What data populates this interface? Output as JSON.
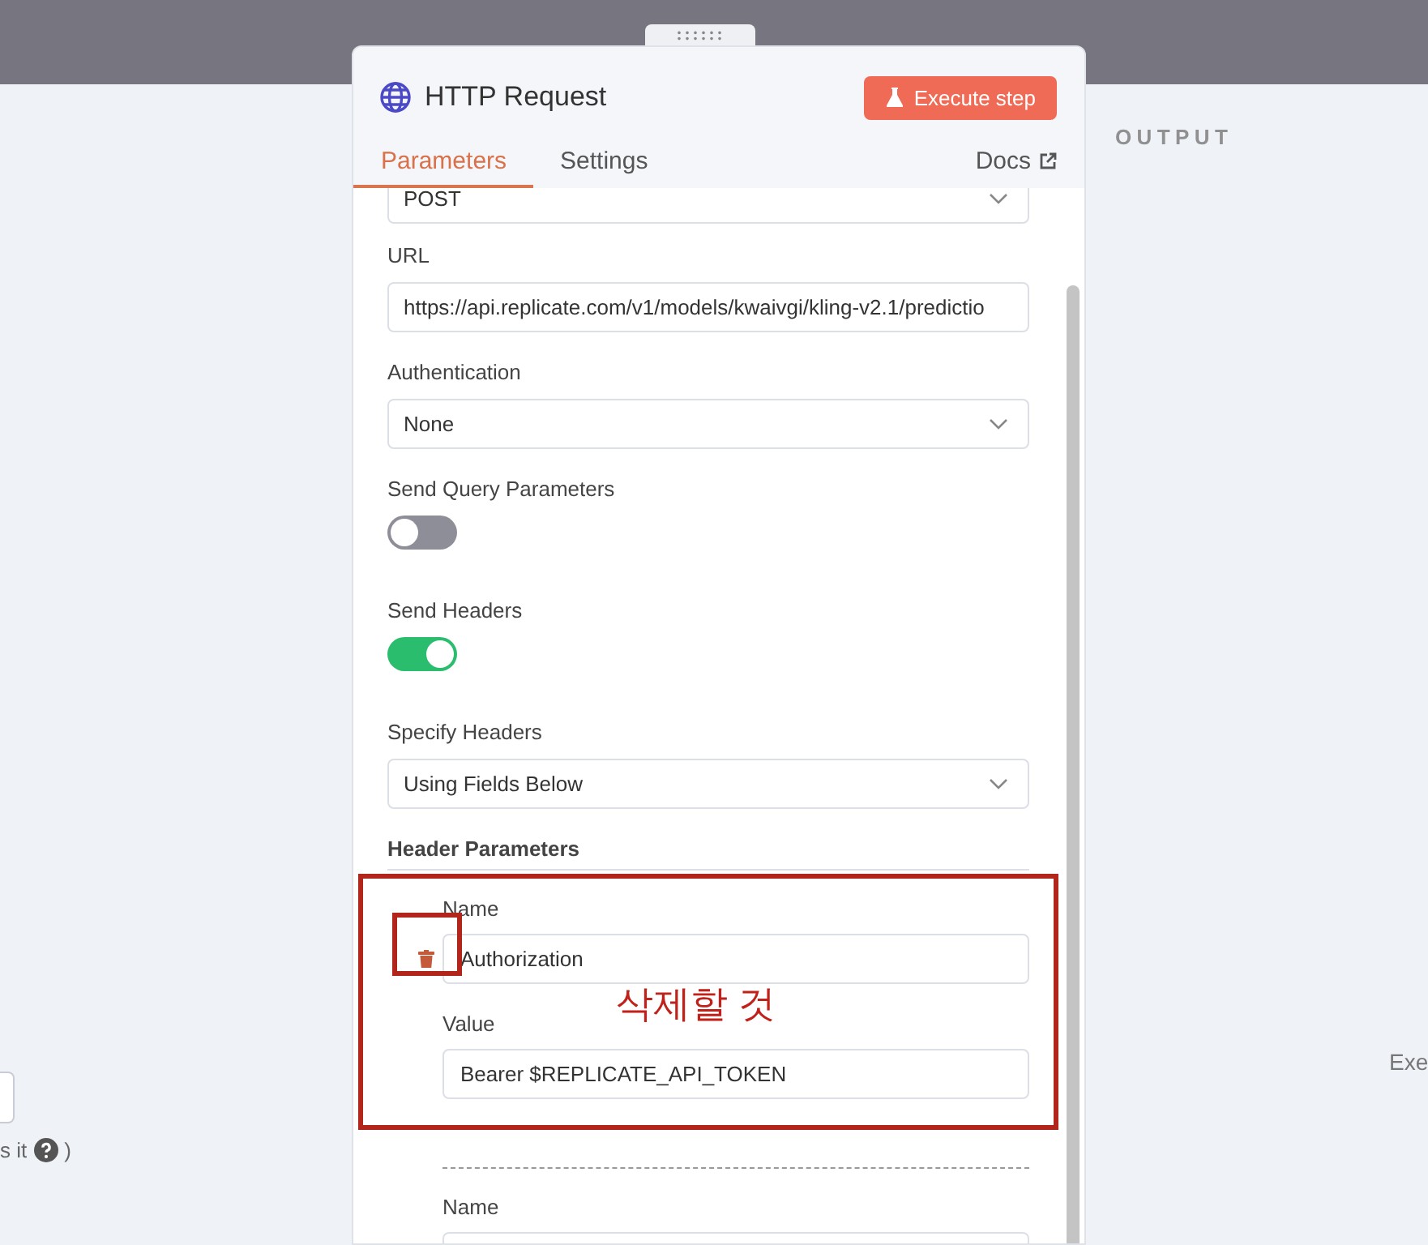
{
  "input_pane": {
    "hint_text": "s it",
    "hint_close": ")"
  },
  "panel": {
    "title": "HTTP Request",
    "execute_button": "Execute step",
    "tabs": [
      {
        "label": "Parameters",
        "selected": true
      },
      {
        "label": "Settings",
        "selected": false
      }
    ],
    "docs_link": "Docs",
    "fields": [
      {
        "kind": "select",
        "value": "POST"
      },
      {
        "kind": "input",
        "label": "URL",
        "value": "https://api.replicate.com/v1/models/kwaivgi/kling-v2.1/predictio"
      },
      {
        "kind": "select",
        "label": "Authentication",
        "value": "None"
      },
      {
        "kind": "toggle",
        "label": "Send Query Parameters",
        "on": false
      },
      {
        "kind": "toggle",
        "label": "Send Headers",
        "on": true
      },
      {
        "kind": "select",
        "label": "Specify Headers",
        "value": "Using Fields Below"
      }
    ],
    "header_parameters": {
      "title": "Header Parameters",
      "items": [
        {
          "name_label": "Name",
          "name_value": "Authorization",
          "value_label": "Value",
          "value_value": "Bearer $REPLICATE_API_TOKEN"
        },
        {
          "name_label": "Name"
        }
      ]
    }
  },
  "output_pane": {
    "title": "OUTPUT",
    "partial_text": "Exe"
  },
  "annotation": {
    "text": "삭제할 것"
  }
}
